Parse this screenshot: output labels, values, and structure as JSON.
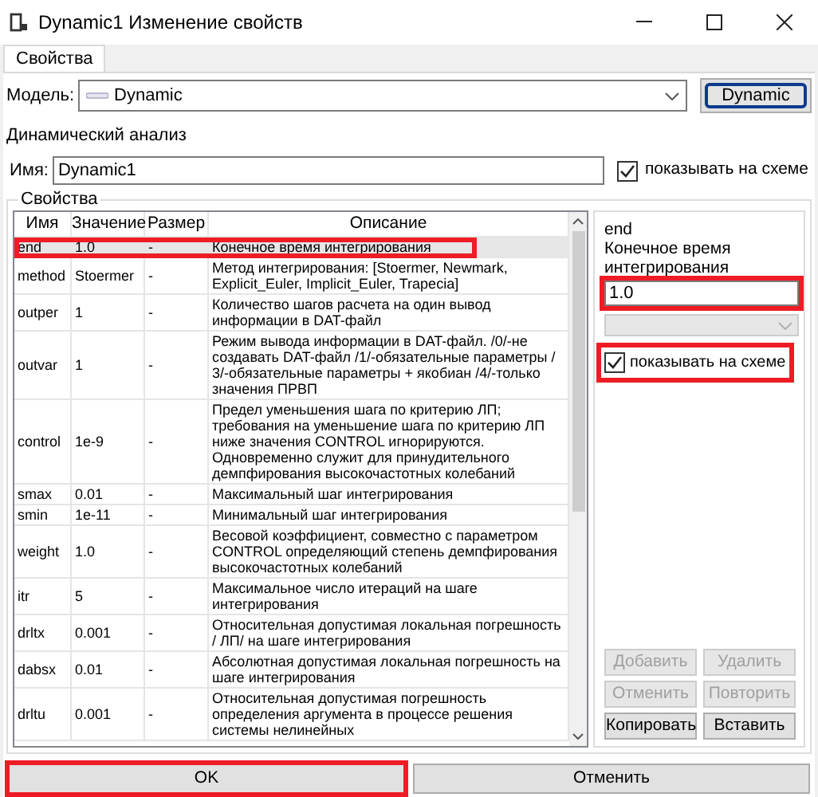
{
  "window": {
    "title": "Dynamic1 Изменение свойств"
  },
  "tabs": [
    {
      "label": "Свойства",
      "selected": true
    }
  ],
  "model": {
    "label": "Модель:",
    "value": "Dynamic",
    "button": "Dynamic"
  },
  "analysis_label": "Динамический анализ",
  "name": {
    "label": "Имя:",
    "value": "Dynamic1",
    "show_on_scheme": {
      "label": "показывать на схеме",
      "checked": true
    }
  },
  "properties": {
    "group_title": "Свойства",
    "columns": [
      "Имя",
      "Значение",
      "Размер",
      "Описание"
    ],
    "rows": [
      {
        "name": "end",
        "value": "1.0",
        "size": "-",
        "description": "Конечное время интегрирования",
        "selected": true,
        "highlighted": true
      },
      {
        "name": "method",
        "value": "Stoermer",
        "size": "-",
        "description": "Метод интегрирования: [Stoermer, Newmark, Explicit_Euler, Implicit_Euler, Trapecia]",
        "selected": false,
        "highlighted": false
      },
      {
        "name": "outper",
        "value": "1",
        "size": "-",
        "description": "Количество шагов расчета на один вывод информации в DAT-файл",
        "selected": false,
        "highlighted": false
      },
      {
        "name": "outvar",
        "value": "1",
        "size": "-",
        "description": "Режим вывода информации в DAT-файл. /0/-не создавать DAT-файл /1/-обязательные параметры / 3/-обязательные параметры + якобиан /4/-только значения ПРВП",
        "selected": false,
        "highlighted": false
      },
      {
        "name": "control",
        "value": "1e-9",
        "size": "-",
        "description": "Предел уменьшения шага по критерию ЛП; требования на уменьшение шага по критерию ЛП ниже значения CONTROL игнорируются. Одновременно служит для принудительного демпфирования высокочастотных колебаний",
        "selected": false,
        "highlighted": false
      },
      {
        "name": "smax",
        "value": "0.01",
        "size": "-",
        "description": "Максимальный шаг интегрирования",
        "selected": false,
        "highlighted": false
      },
      {
        "name": "smin",
        "value": "1e-11",
        "size": "-",
        "description": "Минимальный шаг интегрирования",
        "selected": false,
        "highlighted": false
      },
      {
        "name": "weight",
        "value": "1.0",
        "size": "-",
        "description": "Весовой коэффициент, совместно с параметром CONTROL определяющий степень демпфирования высокочастотных колебаний",
        "selected": false,
        "highlighted": false
      },
      {
        "name": "itr",
        "value": "5",
        "size": "-",
        "description": "Максимальное число итераций на шаге интегрирования",
        "selected": false,
        "highlighted": false
      },
      {
        "name": "drltx",
        "value": "0.001",
        "size": "-",
        "description": "Относительная допустимая локальная погрешность / ЛП/ на шаге интегрирования",
        "selected": false,
        "highlighted": false
      },
      {
        "name": "dabsx",
        "value": "0.01",
        "size": "-",
        "description": "Абсолютная допустимая локальная погрешность на шаге интегрирования",
        "selected": false,
        "highlighted": false
      },
      {
        "name": "drltu",
        "value": "0.001",
        "size": "-",
        "description": "Относительная допустимая погрешность определения аргумента в процессе решения системы нелинейных",
        "selected": false,
        "highlighted": false
      }
    ]
  },
  "editor": {
    "name": "end",
    "description": "Конечное время интегрирования",
    "value": "1.0",
    "value_highlighted": true,
    "unit_field": {
      "disabled": true
    },
    "show_on_scheme": {
      "label": "показывать на схеме",
      "checked": true,
      "highlighted": true
    },
    "buttons": [
      {
        "label": "Добавить",
        "disabled": true
      },
      {
        "label": "Удалить",
        "disabled": true
      },
      {
        "label": "Отменить",
        "disabled": true
      },
      {
        "label": "Повторить",
        "disabled": true
      },
      {
        "label": "Копировать",
        "disabled": false
      },
      {
        "label": "Вставить",
        "disabled": false
      }
    ]
  },
  "buttons": [
    {
      "label": "OK",
      "highlighted": true
    },
    {
      "label": "Отменить",
      "highlighted": false
    }
  ]
}
